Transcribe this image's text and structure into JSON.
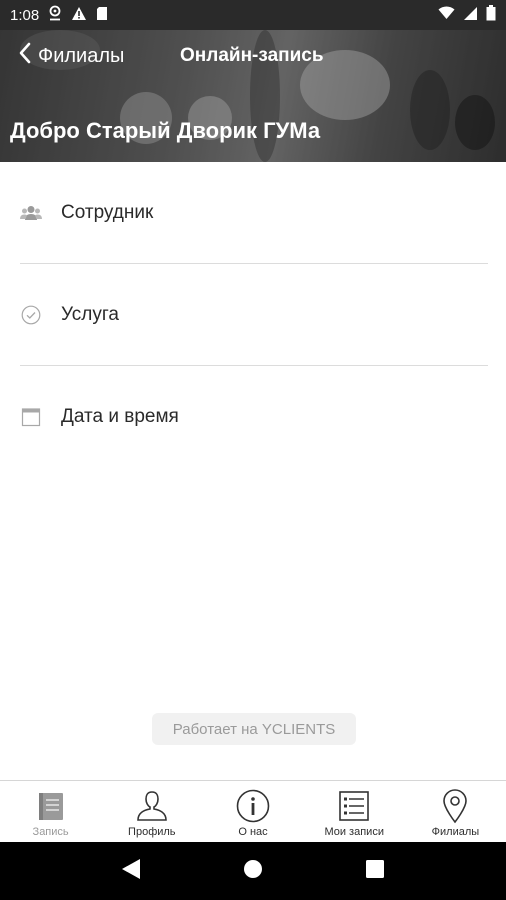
{
  "status_bar": {
    "time": "1:08",
    "icons": [
      "location-icon",
      "warning-icon",
      "sim-card-icon",
      "wifi-icon",
      "signal-icon",
      "battery-icon"
    ]
  },
  "header": {
    "back_label": "Филиалы",
    "title": "Онлайн-запись",
    "branch_name": "Добро Старый Дворик ГУМа"
  },
  "menu": {
    "items": [
      {
        "label": "Сотрудник",
        "icon": "staff-icon"
      },
      {
        "label": "Услуга",
        "icon": "check-circle-icon"
      },
      {
        "label": "Дата и время",
        "icon": "calendar-icon"
      }
    ]
  },
  "powered_by": "Работает на YCLIENTS",
  "tabs": [
    {
      "label": "Запись",
      "icon": "book-icon",
      "active": true
    },
    {
      "label": "Профиль",
      "icon": "person-icon",
      "active": false
    },
    {
      "label": "О нас",
      "icon": "info-icon",
      "active": false
    },
    {
      "label": "Мои записи",
      "icon": "list-icon",
      "active": false
    },
    {
      "label": "Филиалы",
      "icon": "map-pin-icon",
      "active": false
    }
  ],
  "colors": {
    "status_bar": "#2a2a2a",
    "text": "#2a2a2a",
    "divider": "#dcdcdc",
    "inactive_tab": "#9a9a9a"
  }
}
